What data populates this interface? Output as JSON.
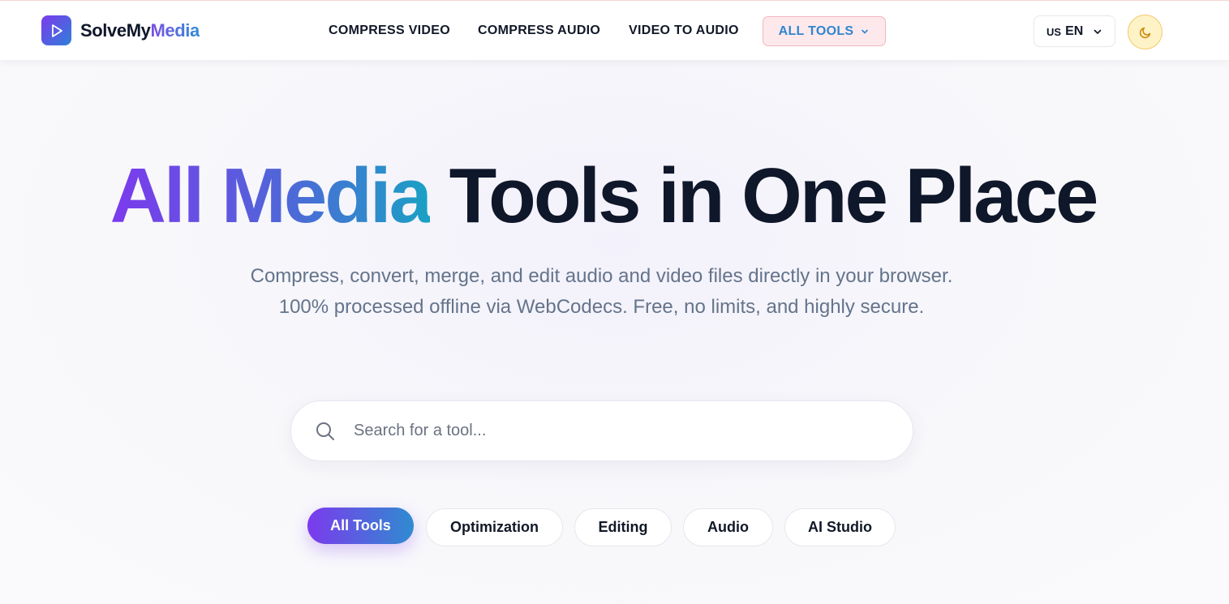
{
  "brand": {
    "name_part1": "Solve",
    "name_part2": "My",
    "name_part3": "Media"
  },
  "nav": {
    "links": [
      "COMPRESS VIDEO",
      "COMPRESS AUDIO",
      "VIDEO TO AUDIO"
    ],
    "all_tools_label": "ALL TOOLS"
  },
  "language": {
    "flag": "US",
    "code": "EN"
  },
  "theme_toggle": {
    "icon": "moon-icon"
  },
  "hero": {
    "title_gradient": "All Media",
    "title_rest": "Tools in One Place",
    "subtitle": "Compress, convert, merge, and edit audio and video files directly in your browser. 100% processed offline via WebCodecs. Free, no limits, and highly secure."
  },
  "search": {
    "placeholder": "Search for a tool...",
    "value": "",
    "icon": "search-icon"
  },
  "filters": {
    "selected": "All Tools",
    "chips": [
      "All Tools",
      "Optimization",
      "Editing",
      "Audio",
      "AI Studio"
    ]
  },
  "colors": {
    "brand_gradient_start": "#7c3aed",
    "brand_gradient_end": "#2f8bd0",
    "all_tools_bg": "#fde8ec",
    "all_tools_text": "#2f86cf",
    "theme_toggle_bg": "#fef3c7"
  }
}
